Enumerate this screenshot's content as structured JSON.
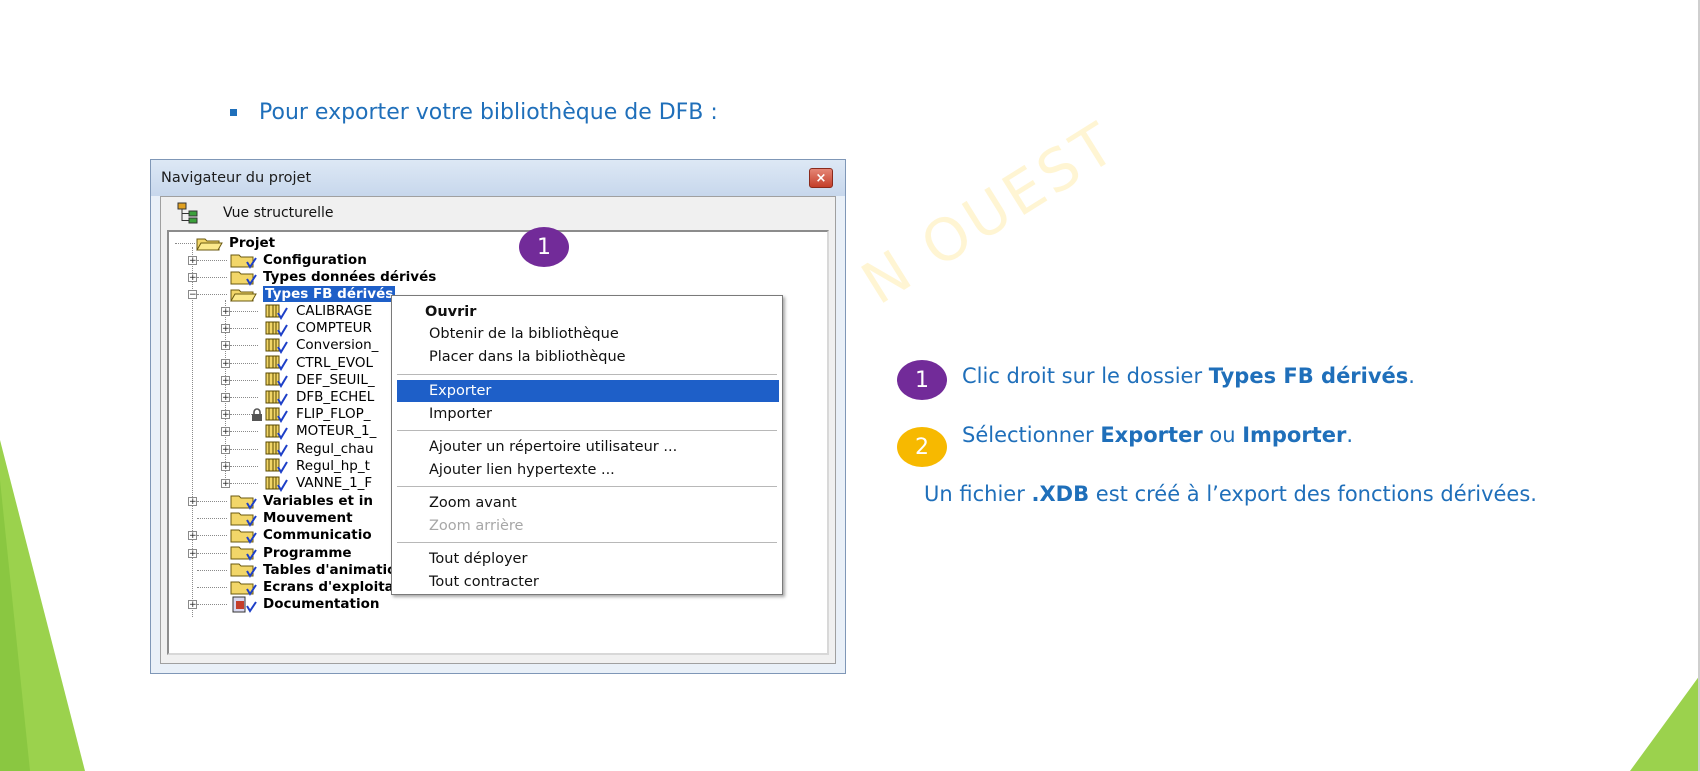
{
  "slide": {
    "bullet_text": "Pour exporter votre bibliothèque de DFB :",
    "watermark_text": "N    OUEST",
    "colors": {
      "accent": "#1f6fba",
      "purple": "#722b99",
      "gold": "#f7b900",
      "green": "#9bd24d",
      "selection": "#1e5fc8"
    }
  },
  "window": {
    "title": "Navigateur du projet",
    "close_glyph": "×",
    "view_label": "Vue structurelle",
    "tree": {
      "root": "Projet",
      "items": [
        {
          "label": "Configuration"
        },
        {
          "label": "Types données dérivés"
        },
        {
          "label": "Types FB dérivés"
        },
        {
          "label": "CALIBRAGE"
        },
        {
          "label": "COMPTEUR"
        },
        {
          "label": "Conversion_"
        },
        {
          "label": "CTRL_EVOL"
        },
        {
          "label": "DEF_SEUIL_"
        },
        {
          "label": "DFB_ECHEL"
        },
        {
          "label": "FLIP_FLOP_"
        },
        {
          "label": "MOTEUR_1_"
        },
        {
          "label": "Regul_chau"
        },
        {
          "label": "Regul_hp_t"
        },
        {
          "label": "VANNE_1_F"
        },
        {
          "label": "Variables et in"
        },
        {
          "label": "Mouvement"
        },
        {
          "label": "Communicatio"
        },
        {
          "label": "Programme"
        },
        {
          "label": "Tables d'animation"
        },
        {
          "label": "Ecrans d'exploitation"
        },
        {
          "label": "Documentation"
        }
      ]
    }
  },
  "context_menu": {
    "items": [
      {
        "label": "Ouvrir"
      },
      {
        "label": "Obtenir de la bibliothèque"
      },
      {
        "label": "Placer dans la bibliothèque"
      },
      {
        "label": "Exporter"
      },
      {
        "label": "Importer"
      },
      {
        "label": "Ajouter un répertoire utilisateur ..."
      },
      {
        "label": "Ajouter lien hypertexte ..."
      },
      {
        "label": "Zoom avant"
      },
      {
        "label": "Zoom arrière"
      },
      {
        "label": "Tout déployer"
      },
      {
        "label": "Tout contracter"
      }
    ]
  },
  "steps": {
    "badge_overlay": "1",
    "step1": {
      "number": "1",
      "prefix": "Clic droit sur le dossier ",
      "bold": "Types FB dérivés",
      "suffix": "."
    },
    "step2": {
      "number": "2",
      "prefix": "Sélectionner ",
      "bold1": "Exporter",
      "middle": " ou ",
      "bold2": "Importer",
      "suffix": "."
    },
    "note": {
      "prefix": "Un fichier ",
      "bold": ".XDB",
      "suffix": " est créé à l’export des fonctions dérivées."
    }
  }
}
